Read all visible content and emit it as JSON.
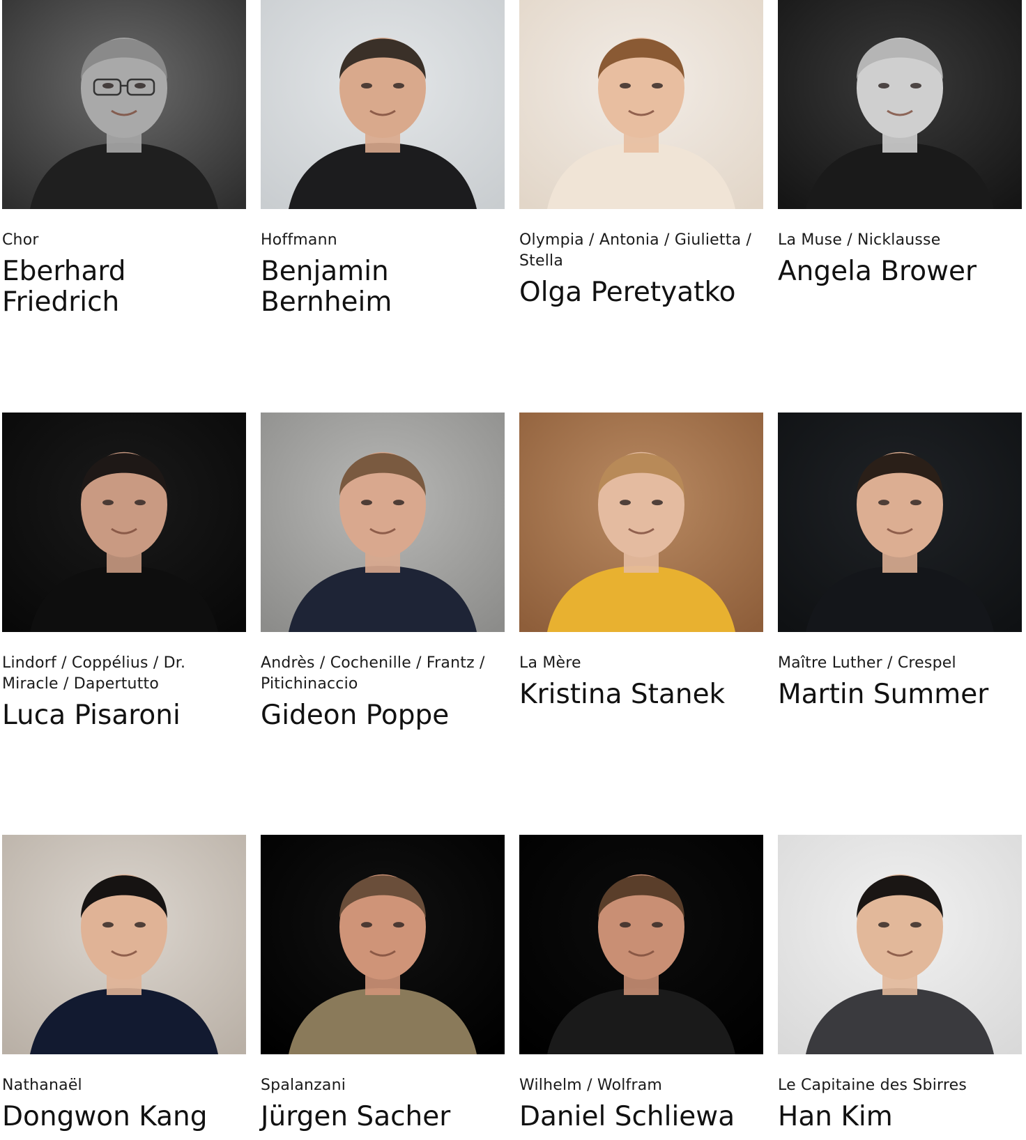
{
  "cast": [
    {
      "role": "Chor",
      "name": "Eberhard Friedrich",
      "photo": {
        "bg": "#6b6b6b",
        "bg2": "#2e2e2e",
        "skin": "#a9a9a9",
        "hair": "#8a8a8a",
        "shirt": "#1f1f1f",
        "glasses": true
      }
    },
    {
      "role": "Hoffmann",
      "name": "Benjamin Bernheim",
      "photo": {
        "bg": "#e3e6e8",
        "bg2": "#c9cdd0",
        "skin": "#d9a98c",
        "hair": "#3a3028",
        "shirt": "#1c1c1e"
      }
    },
    {
      "role": "Olympia / Antonia / Giulietta / Stella",
      "name": "Olga Peretyatko",
      "photo": {
        "bg": "#f2ece6",
        "bg2": "#e2d6c8",
        "skin": "#e8bea0",
        "hair": "#8a5a34",
        "shirt": "#f0e4d6"
      }
    },
    {
      "role": "La Muse / Nicklausse",
      "name": "Angela Brower",
      "photo": {
        "bg": "#3a3a3a",
        "bg2": "#151515",
        "skin": "#cfcfcf",
        "hair": "#b5b5b5",
        "shirt": "#1a1a1a"
      }
    },
    {
      "role": "Lindorf / Coppélius / Dr. Miracle / Dapertutto",
      "name": "Luca Pisaroni",
      "photo": {
        "bg": "#1a1a1a",
        "bg2": "#080808",
        "skin": "#c99a82",
        "hair": "#1e1816",
        "shirt": "#0e0e0e"
      }
    },
    {
      "role": "Andrès / Cochenille / Frantz / Pitichinaccio",
      "name": "Gideon Poppe",
      "photo": {
        "bg": "#b8b8b6",
        "bg2": "#8c8c8a",
        "skin": "#d9a88e",
        "hair": "#7a5a40",
        "shirt": "#1e2436"
      }
    },
    {
      "role": "La Mère",
      "name": "Kristina Stanek",
      "photo": {
        "bg": "#b98a62",
        "bg2": "#8e5e3a",
        "skin": "#e4bba0",
        "hair": "#b88a58",
        "shirt": "#e8b130"
      }
    },
    {
      "role": "Maître Luther / Crespel",
      "name": "Martin Summer",
      "photo": {
        "bg": "#1f2226",
        "bg2": "#0f1113",
        "skin": "#dcae92",
        "hair": "#2a1f18",
        "shirt": "#14161a"
      }
    },
    {
      "role": "Nathanaël",
      "name": "Dongwon Kang",
      "photo": {
        "bg": "#dcd6cf",
        "bg2": "#b9b0a6",
        "skin": "#e0b396",
        "hair": "#161312",
        "shirt": "#121a30"
      }
    },
    {
      "role": "Spalanzani",
      "name": "Jürgen Sacher",
      "photo": {
        "bg": "#111111",
        "bg2": "#000000",
        "skin": "#cf9478",
        "hair": "#6a4e3a",
        "shirt": "#8a7a5a"
      }
    },
    {
      "role": "Wilhelm / Wolfram",
      "name": "Daniel Schliewa",
      "photo": {
        "bg": "#0c0c0c",
        "bg2": "#000000",
        "skin": "#c98f74",
        "hair": "#5a3e2a",
        "shirt": "#1a1a1a"
      }
    },
    {
      "role": "Le Capitaine des Sbirres",
      "name": "Han Kim",
      "photo": {
        "bg": "#f1f1f1",
        "bg2": "#d9d9d9",
        "skin": "#e2b89a",
        "hair": "#1a1614",
        "shirt": "#3a3a3e"
      }
    }
  ]
}
